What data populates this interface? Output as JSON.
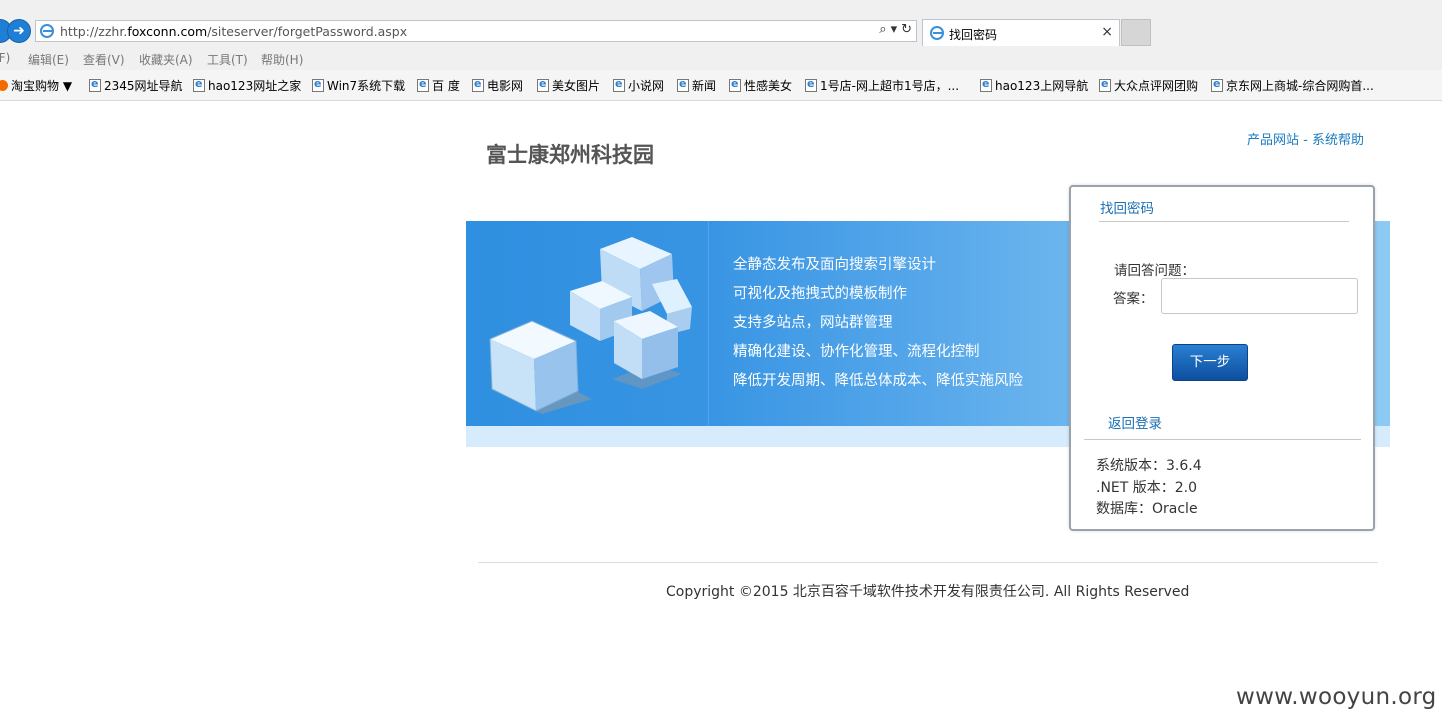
{
  "browser": {
    "url_prefix": "http://zzhr.",
    "url_domain": "foxconn.com",
    "url_path": "/siteserver/forgetPassword.aspx",
    "tab_title": "找回密码",
    "tab_close": "×",
    "nav_back": "",
    "nav_forward": "➜",
    "addr_search": "⌕",
    "addr_dropdown": "▾",
    "addr_refresh": "↻"
  },
  "menu": [
    {
      "label": "(F)"
    },
    {
      "label": "编辑(E)"
    },
    {
      "label": "查看(V)"
    },
    {
      "label": "收藏夹(A)"
    },
    {
      "label": "工具(T)"
    },
    {
      "label": "帮助(H)"
    }
  ],
  "favorites": [
    {
      "label": "淘宝购物 ▼"
    },
    {
      "label": "2345网址导航"
    },
    {
      "label": "hao123网址之家"
    },
    {
      "label": "Win7系统下载"
    },
    {
      "label": "百 度"
    },
    {
      "label": "电影网"
    },
    {
      "label": "美女图片"
    },
    {
      "label": "小说网"
    },
    {
      "label": "新闻"
    },
    {
      "label": "性感美女"
    },
    {
      "label": "1号店-网上超市1号店，..."
    },
    {
      "label": "hao123上网导航"
    },
    {
      "label": "大众点评网团购"
    },
    {
      "label": "京东网上商城-综合网购首..."
    }
  ],
  "header": {
    "site_title": "富士康郑州科技园",
    "link_products": "产品网站",
    "link_sep": " - ",
    "link_help": "系统帮助"
  },
  "banner": {
    "features": [
      "全静态发布及面向搜索引擎设计",
      "可视化及拖拽式的模板制作",
      "支持多站点，网站群管理",
      "精确化建设、协作化管理、流程化控制",
      "降低开发周期、降低总体成本、降低实施风险"
    ]
  },
  "panel": {
    "title": "找回密码",
    "question_label": "请回答问题：",
    "answer_label": "答案：",
    "answer_value": "",
    "next_button": "下一步",
    "back_login": "返回登录",
    "info": [
      "系统版本：3.6.4",
      ".NET 版本：2.0",
      "数据库：Oracle"
    ]
  },
  "footer": {
    "copyright": "Copyright ©2015 北京百容千域软件技术开发有限责任公司. All Rights Reserved"
  },
  "watermark": "www.wooyun.org",
  "colors": {
    "link": "#1a7bc0",
    "banner_start": "#2f8fe0",
    "banner_end": "#8ccaf4",
    "button": "#0d4fa0"
  }
}
